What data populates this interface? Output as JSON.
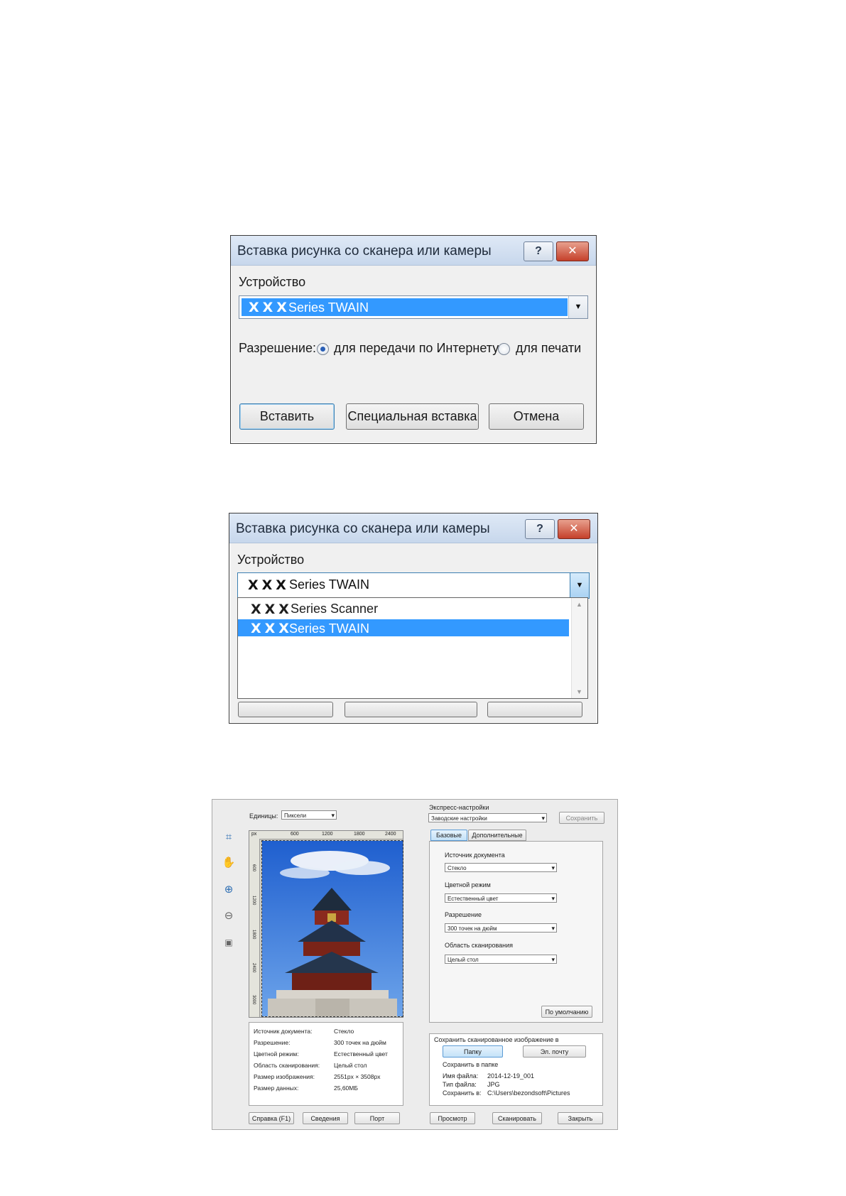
{
  "dialog1": {
    "title": "Вставка рисунка со сканера или камеры",
    "help_icon": "question-icon",
    "close_icon": "close-x-icon",
    "device_label": "Устройство",
    "device_value_prefix": "XXX",
    "device_value": "Series TWAIN",
    "resolution_label": "Разрешение:",
    "radio_internet": "для передачи по Интернету",
    "radio_print": "для печати",
    "radio_selected": "internet",
    "insert_button": "Вставить",
    "special_insert_button": "Специальная вставка",
    "cancel_button": "Отмена"
  },
  "dialog2": {
    "title": "Вставка рисунка со сканера или камеры",
    "device_label": "Устройство",
    "device_value_prefix": "XXX",
    "device_value": "Series TWAIN",
    "options": [
      {
        "prefix": "XXX",
        "label": "Series Scanner"
      },
      {
        "prefix": "XXX",
        "label": "Series TWAIN"
      }
    ],
    "selected_option": 1
  },
  "scanner": {
    "units_label": "Единицы:",
    "units_value": "Пиксели",
    "ruler_unit": "px",
    "ruler_ticks": [
      "600",
      "1200",
      "1800",
      "2400"
    ],
    "ruler_vticks": [
      "600",
      "1200",
      "1800",
      "2400",
      "3000"
    ],
    "tools": [
      "crop-icon",
      "hand-icon",
      "zoom-in-icon",
      "zoom-out-icon",
      "trash-icon"
    ],
    "express_label": "Экспресс-настройки",
    "express_value": "Заводские настройки",
    "save_button": "Сохранить",
    "tab_basic": "Базовые",
    "tab_advanced": "Дополнительные",
    "fields": [
      {
        "label": "Источник документа",
        "value": "Стекло"
      },
      {
        "label": "Цветной режим",
        "value": "Естественный цвет"
      },
      {
        "label": "Разрешение",
        "value": "300 точек на дюйм"
      },
      {
        "label": "Область сканирования",
        "value": "Целый стол"
      }
    ],
    "default_button": "По умолчанию",
    "info": [
      {
        "label": "Источник документа:",
        "value": "Стекло"
      },
      {
        "label": "Разрешение:",
        "value": "300 точек на дюйм"
      },
      {
        "label": "Цветной режим:",
        "value": "Естественный цвет"
      },
      {
        "label": "Область сканирования:",
        "value": "Целый стол"
      },
      {
        "label": "Размер изображения:",
        "value": "2551px × 3508px"
      },
      {
        "label": "Размер данных:",
        "value": "25,60МБ"
      }
    ],
    "save_to_label": "Сохранить сканированное изображение в",
    "folder_button": "Папку",
    "email_button": "Эл. почту",
    "save_in_folder": "Сохранить в папке",
    "file_info": [
      {
        "label": "Имя файла:",
        "value": "2014-12-19_001"
      },
      {
        "label": "Тип файла:",
        "value": "JPG"
      },
      {
        "label": "Сохранить в:",
        "value": "C:\\Users\\bezondsoft\\Pictures"
      }
    ],
    "help_button": "Справка (F1)",
    "about_button": "Сведения",
    "spacer_button": "Порт",
    "preview_button": "Просмотр",
    "scan_button": "Сканировать",
    "close_button": "Закрыть"
  }
}
